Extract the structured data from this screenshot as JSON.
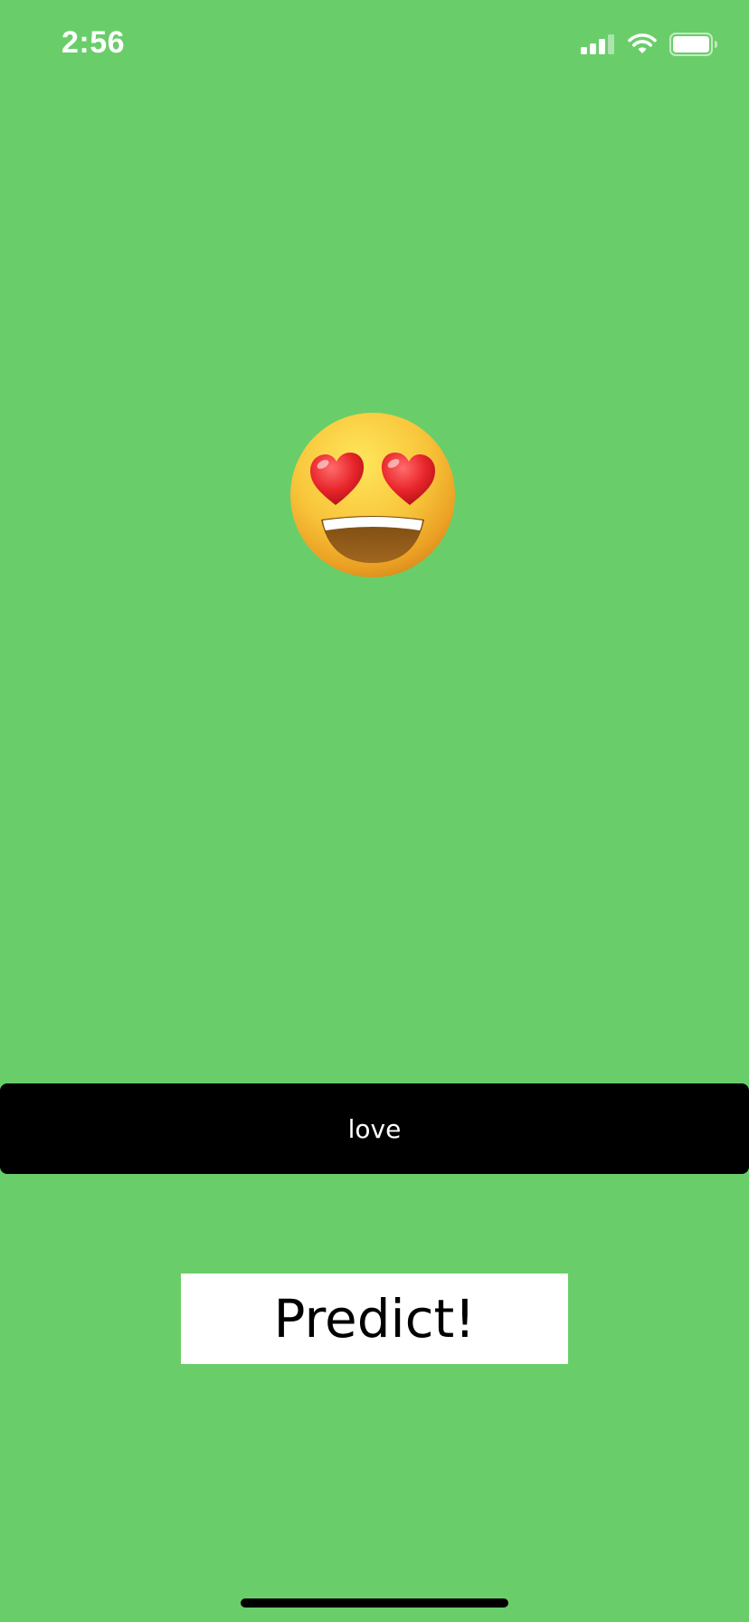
{
  "status_bar": {
    "time": "2:56",
    "signal_icon": "cellular-signal-icon",
    "wifi_icon": "wifi-icon",
    "battery_icon": "battery-icon"
  },
  "emoji": {
    "name": "heart-eyes-face-icon"
  },
  "text_field": {
    "value": "love"
  },
  "predict_button": {
    "label": "Predict!"
  },
  "colors": {
    "background": "#69CE6A",
    "text_field_bg": "#000000",
    "button_bg": "#FFFFFF"
  }
}
